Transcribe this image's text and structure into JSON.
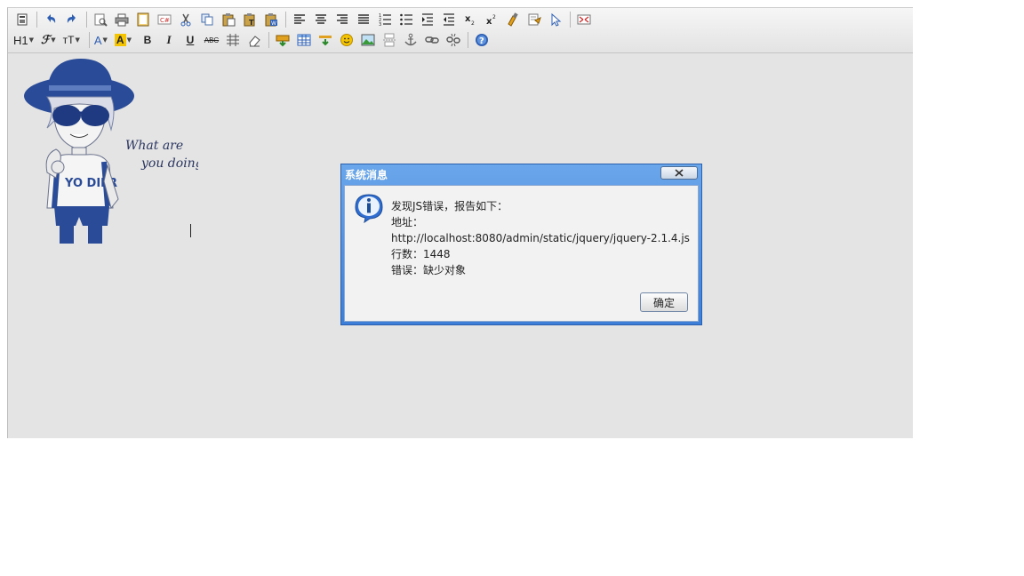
{
  "toolbar": {
    "row1_icons": [
      "source-icon",
      "undo-icon",
      "redo-icon",
      "preview-icon",
      "print-icon",
      "template-icon",
      "code-icon",
      "cut-icon",
      "copy-icon",
      "paste-icon",
      "paste-text-icon",
      "paste-word-icon",
      "align-left-icon",
      "align-center-icon",
      "align-right-icon",
      "align-justify-icon",
      "ordered-list-icon",
      "unordered-list-icon",
      "indent-icon",
      "outdent-icon",
      "subscript-icon",
      "superscript-icon",
      "clear-format-icon",
      "select-all-icon",
      "pointer-icon",
      "fullscreen-icon"
    ],
    "heading_label": "H1",
    "font_label": "ℱ",
    "size_label": "тT",
    "forecolor_label": "A",
    "highlight_label": "A",
    "bold_label": "B",
    "italic_label": "I",
    "underline_label": "U",
    "strike_label": "ABC",
    "row2_icons": [
      "line-height-icon",
      "eraser-icon",
      "insert-image-icon",
      "table-icon",
      "hr-icon",
      "emoticon-icon",
      "image-icon",
      "pagebreak-icon",
      "anchor-icon",
      "link-icon",
      "unlink-icon",
      "help-icon"
    ],
    "colors": {
      "accent": "#3d7fd8",
      "highlight": "#f5c400",
      "icon_blue": "#2f5fb3"
    }
  },
  "illustration": {
    "caption_line1": "What are",
    "caption_line2": "you doing?",
    "shirt_text": "YO DIER"
  },
  "dialog": {
    "title": "系统消息",
    "close_label": "X",
    "lines": [
      "发现JS错误，报告如下：",
      "地址：",
      "http://localhost:8080/admin/static/jquery/jquery-2.1.4.js",
      "行数：1448",
      "错误：缺少对象"
    ],
    "ok_label": "确定"
  }
}
